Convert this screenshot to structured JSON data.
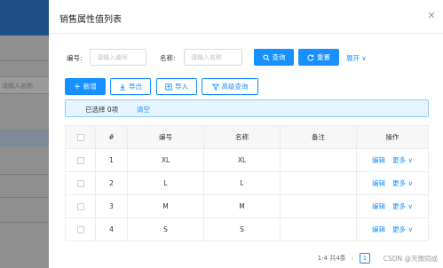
{
  "background": {
    "search_placeholder": "请输入名称"
  },
  "dialog": {
    "title": "销售属性值列表",
    "close_icon": "close-icon"
  },
  "search": {
    "code_label": "编号:",
    "code_placeholder": "请输入编号",
    "name_label": "名称:",
    "name_placeholder": "请输入名称",
    "query_label": "查询",
    "reset_label": "重置",
    "expand_label": "展开"
  },
  "toolbar": {
    "add_label": "新增",
    "export_label": "导出",
    "import_label": "导入",
    "advanced_label": "高级查询"
  },
  "selection": {
    "info": "已选择 0项",
    "clear_label": "清空"
  },
  "table": {
    "columns": [
      "#",
      "编号",
      "名称",
      "备注",
      "操作"
    ],
    "rows": [
      {
        "index": "1",
        "code": "XL",
        "name": "XL",
        "remark": "",
        "edit": "编辑",
        "more": "更多"
      },
      {
        "index": "2",
        "code": "L",
        "name": "L",
        "remark": "",
        "edit": "编辑",
        "more": "更多"
      },
      {
        "index": "3",
        "code": "M",
        "name": "M",
        "remark": "",
        "edit": "编辑",
        "more": "更多"
      },
      {
        "index": "4",
        "code": "S",
        "name": "S",
        "remark": "",
        "edit": "编辑",
        "more": "更多"
      }
    ]
  },
  "pagination": {
    "summary": "1-4 共4条",
    "current_page": "1"
  },
  "watermark": "CSDN @天微同成",
  "colors": {
    "primary": "#1890ff",
    "header_bg": "#1f4f87"
  }
}
